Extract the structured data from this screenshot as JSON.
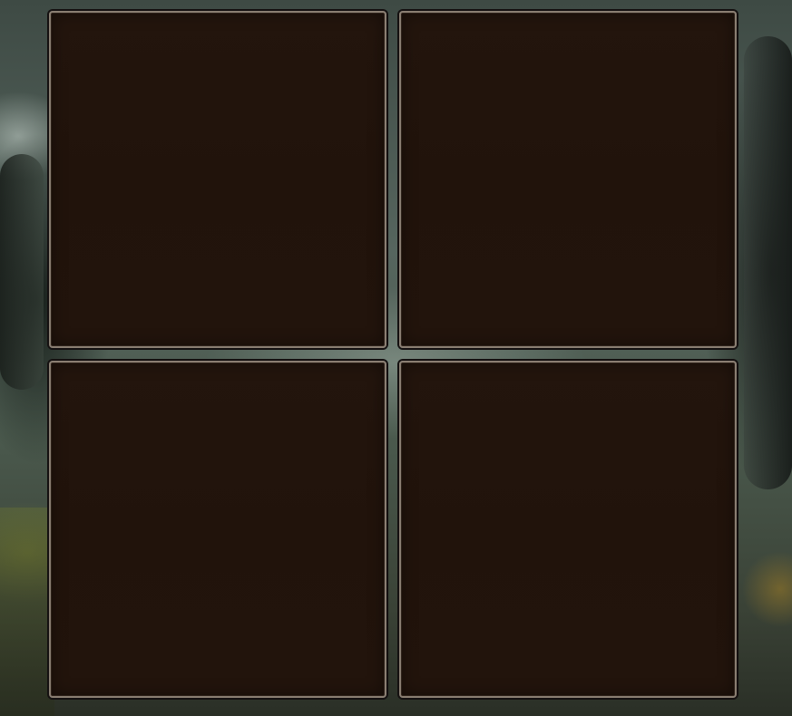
{
  "scene": {
    "background": "forest-illustration",
    "panel_color": "#21130b",
    "panel_border_color": "#8a7e72"
  },
  "panels": [
    {
      "id": "top-left",
      "content": ""
    },
    {
      "id": "top-right",
      "content": ""
    },
    {
      "id": "bottom-left",
      "content": ""
    },
    {
      "id": "bottom-right",
      "content": ""
    }
  ]
}
